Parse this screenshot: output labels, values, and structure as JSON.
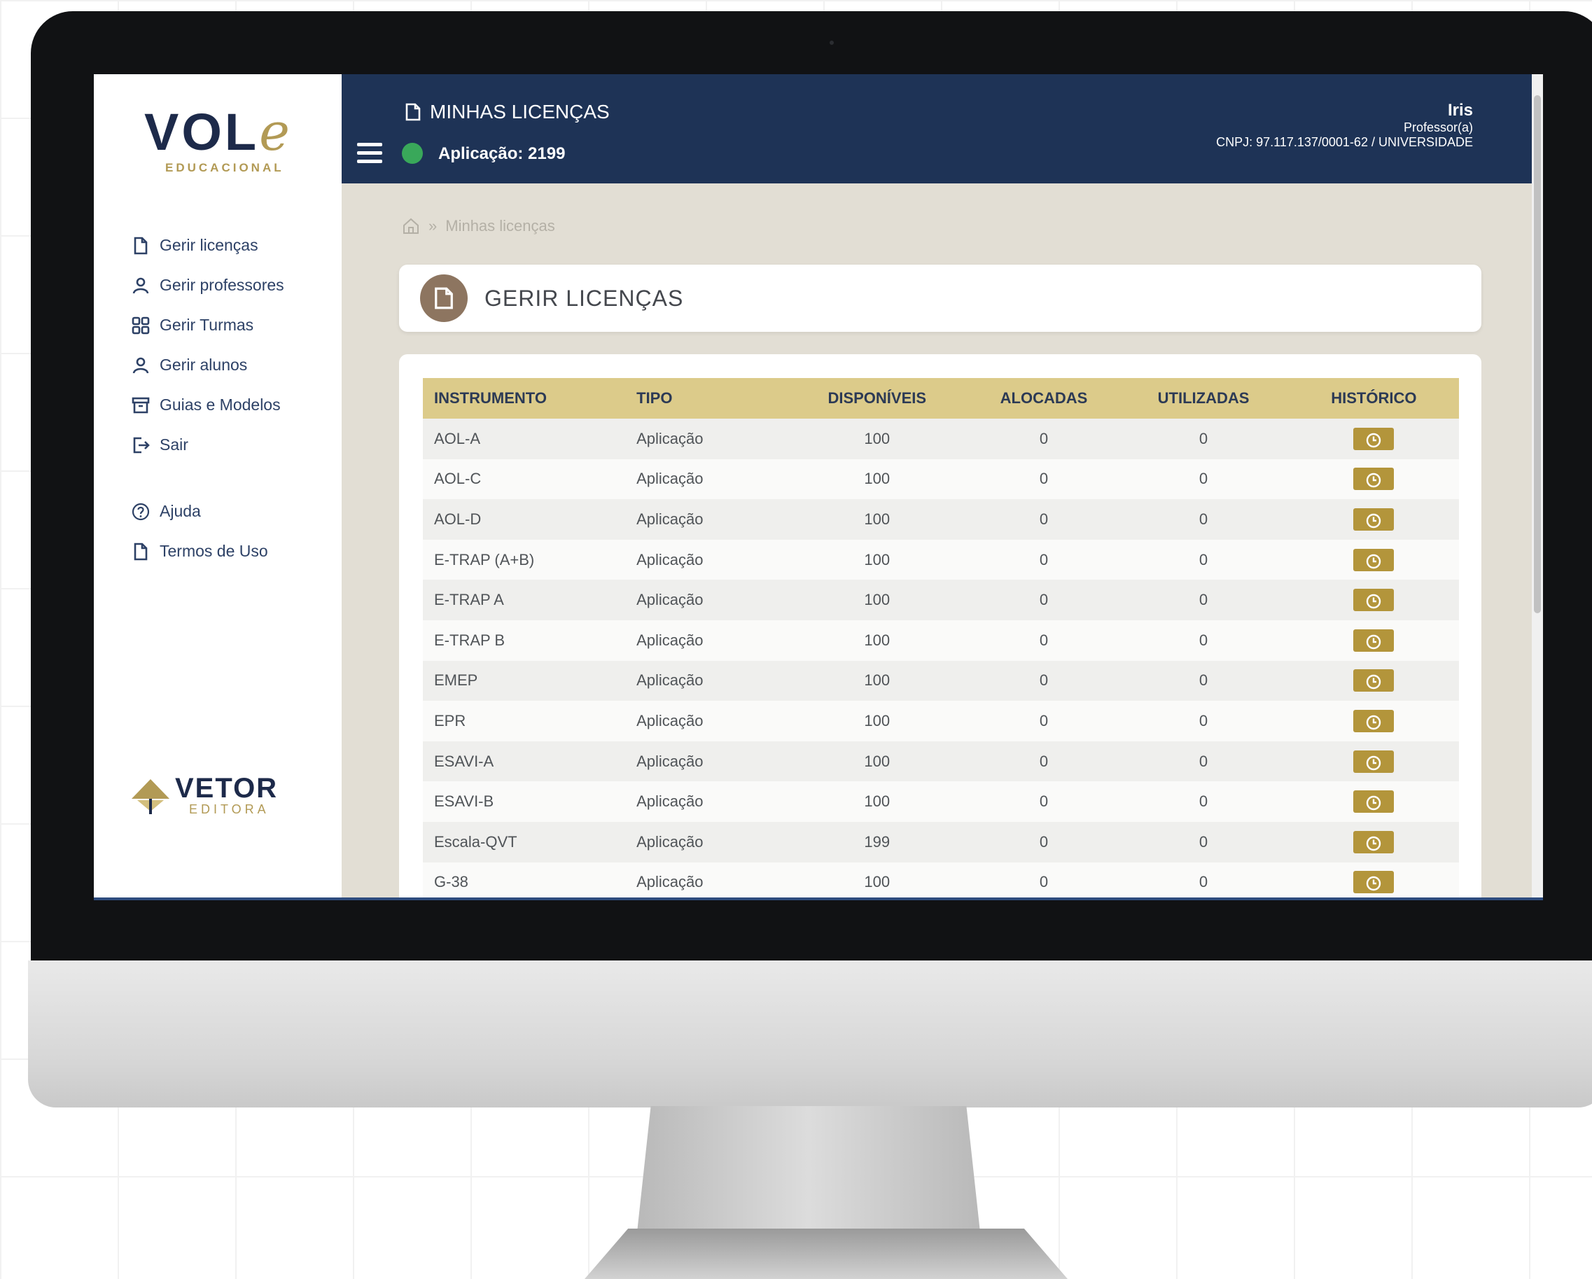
{
  "sidebar": {
    "logo": {
      "word": "VOL",
      "word_e": "e",
      "subtitle": "EDUCACIONAL"
    },
    "nav": [
      {
        "label": "Gerir licenças",
        "icon": "document-icon"
      },
      {
        "label": "Gerir professores",
        "icon": "user-icon"
      },
      {
        "label": "Gerir Turmas",
        "icon": "grid-icon"
      },
      {
        "label": "Gerir alunos",
        "icon": "user-icon"
      },
      {
        "label": "Guias e Modelos",
        "icon": "archive-icon"
      },
      {
        "label": "Sair",
        "icon": "logout-icon"
      }
    ],
    "nav2": [
      {
        "label": "Ajuda",
        "icon": "help-icon"
      },
      {
        "label": "Termos de Uso",
        "icon": "document-icon"
      }
    ],
    "footer_logo": {
      "name": "VETOR",
      "subtitle": "EDITORA"
    }
  },
  "topbar": {
    "title": "MINHAS LICENÇAS",
    "application_label": "Aplicação: 2199",
    "user": {
      "name": "Iris",
      "role": "Professor(a)",
      "org": "CNPJ: 97.117.137/0001-62 / UNIVERSIDADE"
    }
  },
  "breadcrumb": {
    "separator": "»",
    "current": "Minhas licenças"
  },
  "page_title": "GERIR LICENÇAS",
  "table": {
    "headers": [
      "INSTRUMENTO",
      "TIPO",
      "DISPONÍVEIS",
      "ALOCADAS",
      "UTILIZADAS",
      "HISTÓRICO"
    ],
    "rows": [
      [
        "AOL-A",
        "Aplicação",
        "100",
        "0",
        "0"
      ],
      [
        "AOL-C",
        "Aplicação",
        "100",
        "0",
        "0"
      ],
      [
        "AOL-D",
        "Aplicação",
        "100",
        "0",
        "0"
      ],
      [
        "E-TRAP (A+B)",
        "Aplicação",
        "100",
        "0",
        "0"
      ],
      [
        "E-TRAP A",
        "Aplicação",
        "100",
        "0",
        "0"
      ],
      [
        "E-TRAP B",
        "Aplicação",
        "100",
        "0",
        "0"
      ],
      [
        "EMEP",
        "Aplicação",
        "100",
        "0",
        "0"
      ],
      [
        "EPR",
        "Aplicação",
        "100",
        "0",
        "0"
      ],
      [
        "ESAVI-A",
        "Aplicação",
        "100",
        "0",
        "0"
      ],
      [
        "ESAVI-B",
        "Aplicação",
        "100",
        "0",
        "0"
      ],
      [
        "Escala-QVT",
        "Aplicação",
        "199",
        "0",
        "0"
      ],
      [
        "G-38",
        "Aplicação",
        "100",
        "0",
        "0"
      ]
    ]
  },
  "colors": {
    "topbar_bg": "#1e3356",
    "accent_gold": "#b3953b",
    "table_header_bg": "#dccb8a",
    "content_bg": "#e2ded4",
    "badge_green": "#39a85a"
  }
}
